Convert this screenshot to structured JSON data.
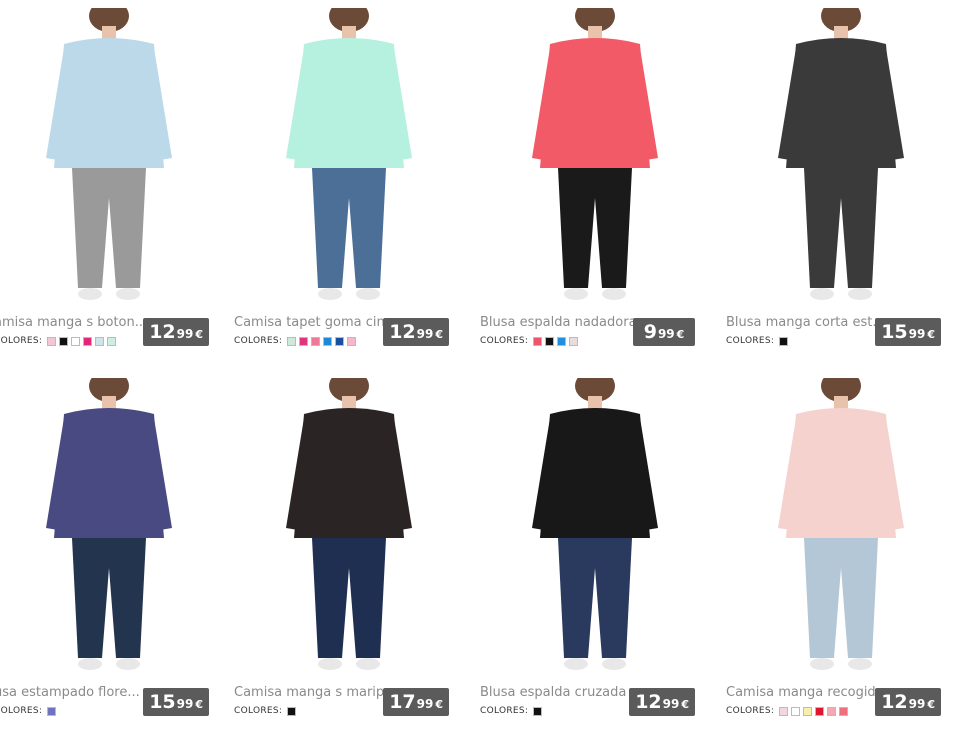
{
  "colors_label": "COLORES:",
  "products": [
    {
      "name": "amisa manga s boton...",
      "price_int": "12",
      "price_dec": "99",
      "currency": "€",
      "swatches": [
        "#f3c6d6",
        "#111111",
        "#ffffff",
        "#e2277b",
        "#cfe4ea",
        "#cdeee0"
      ],
      "shirt": "#bcd9ea",
      "bottom": "#9a9a9a"
    },
    {
      "name": "Camisa tapet goma cin...",
      "price_int": "12",
      "price_dec": "99",
      "currency": "€",
      "swatches": [
        "#cfe9dd",
        "#e0357a",
        "#f07898",
        "#1e88d8",
        "#1a4f9e",
        "#f5b8c8"
      ],
      "shirt": "#b6f0df",
      "bottom": "#4b6f97"
    },
    {
      "name": "Blusa espalda nadadora...",
      "price_int": "9",
      "price_dec": "99",
      "currency": "€",
      "swatches": [
        "#f0546b",
        "#111111",
        "#1e8ee0",
        "#e8dcdc"
      ],
      "shirt": "#f25a68",
      "bottom": "#1a1a1a"
    },
    {
      "name": "Blusa manga corta est...",
      "price_int": "15",
      "price_dec": "99",
      "currency": "€",
      "swatches": [
        "#111111"
      ],
      "shirt": "#3a3a3a",
      "bottom": "#3a3a3a"
    },
    {
      "name": "usa estampado flore...",
      "price_int": "15",
      "price_dec": "99",
      "currency": "€",
      "swatches": [
        "#6f72c0"
      ],
      "shirt": "#4a4a82",
      "bottom": "#23344f"
    },
    {
      "name": "Camisa manga s marip...",
      "price_int": "17",
      "price_dec": "99",
      "currency": "€",
      "swatches": [
        "#111111"
      ],
      "shirt": "#2a2424",
      "bottom": "#1f2f52"
    },
    {
      "name": "Blusa espalda cruzada",
      "price_int": "12",
      "price_dec": "99",
      "currency": "€",
      "swatches": [
        "#111111"
      ],
      "shirt": "#181818",
      "bottom": "#2a3a5e"
    },
    {
      "name": "Camisa manga recogid...",
      "price_int": "12",
      "price_dec": "99",
      "currency": "€",
      "swatches": [
        "#f4d7dc",
        "#ffffff",
        "#f5efb0",
        "#e0172c",
        "#f3a8b4",
        "#ef6f7e"
      ],
      "shirt": "#f6d2cf",
      "bottom": "#b4c7d6"
    }
  ]
}
